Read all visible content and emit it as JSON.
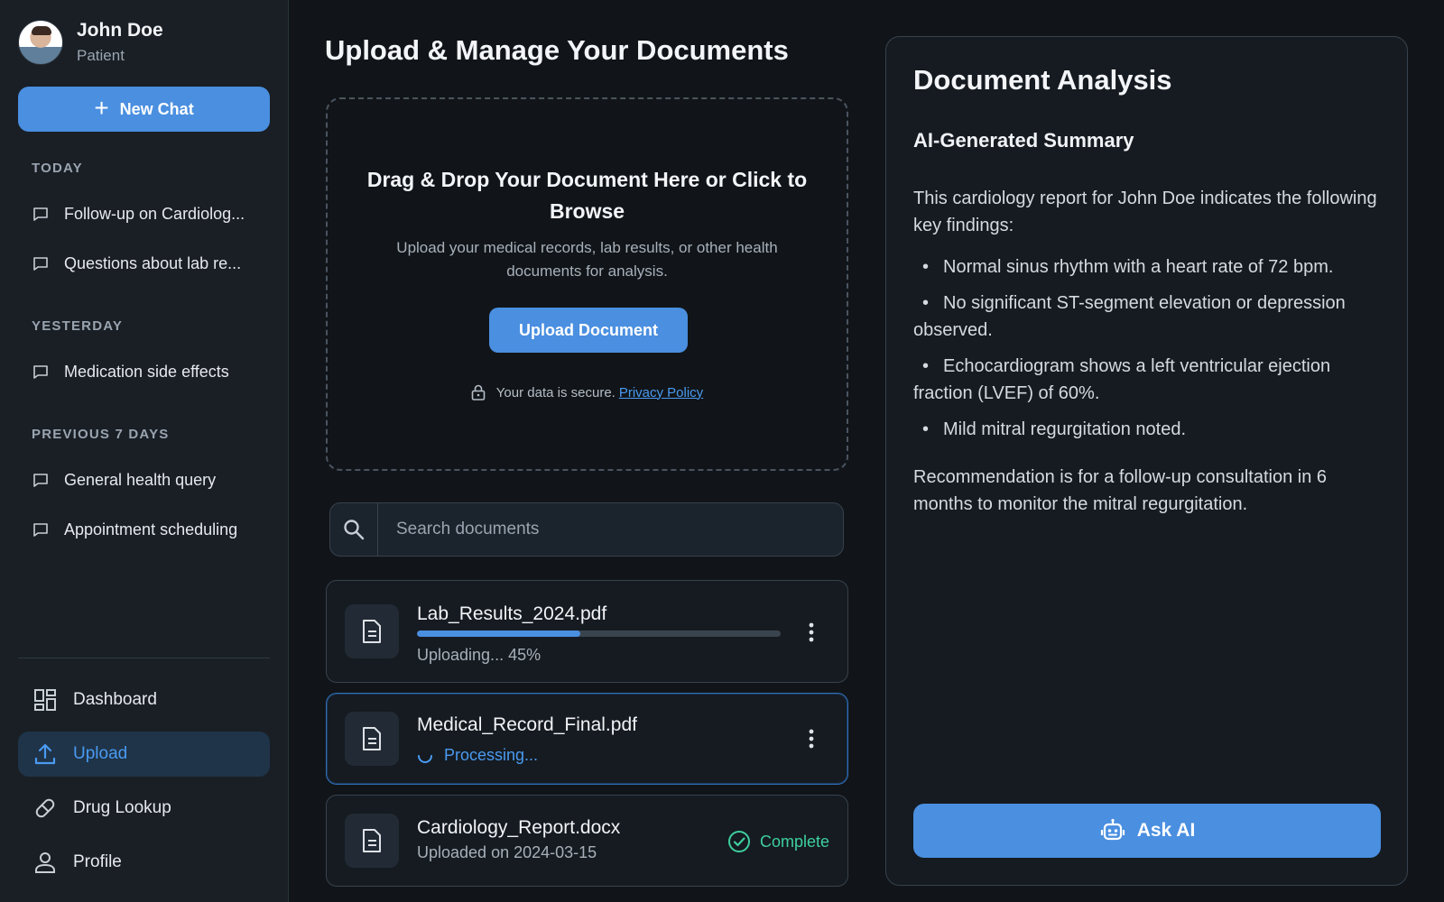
{
  "user": {
    "name": "John Doe",
    "role": "Patient"
  },
  "sidebar": {
    "new_chat_label": "New Chat",
    "sections": [
      {
        "label": "TODAY",
        "items": [
          "Follow-up on Cardiolog...",
          "Questions about lab re..."
        ]
      },
      {
        "label": "YESTERDAY",
        "items": [
          "Medication side effects"
        ]
      },
      {
        "label": "PREVIOUS 7 DAYS",
        "items": [
          "General health query",
          "Appointment scheduling"
        ]
      }
    ],
    "nav": [
      {
        "label": "Dashboard",
        "icon": "dashboard-icon",
        "active": false
      },
      {
        "label": "Upload",
        "icon": "upload-icon",
        "active": true
      },
      {
        "label": "Drug Lookup",
        "icon": "pill-icon",
        "active": false
      },
      {
        "label": "Profile",
        "icon": "person-icon",
        "active": false
      }
    ]
  },
  "main": {
    "title": "Upload & Manage Your Documents",
    "dropzone": {
      "title": "Drag & Drop Your Document Here or Click to Browse",
      "subtitle": "Upload your medical records, lab results, or other health documents for analysis.",
      "button_label": "Upload Document",
      "secure_text": "Your data is secure.",
      "privacy_link": "Privacy Policy"
    },
    "search": {
      "placeholder": "Search documents",
      "value": ""
    },
    "files": [
      {
        "name": "Lab_Results_2024.pdf",
        "status": "uploading",
        "status_text": "Uploading... 45%",
        "progress": 0.45
      },
      {
        "name": "Medical_Record_Final.pdf",
        "status": "processing",
        "status_text": "Processing..."
      },
      {
        "name": "Cardiology_Report.docx",
        "status": "complete",
        "status_text": "Uploaded on 2024-03-15",
        "badge": "Complete"
      }
    ]
  },
  "analysis": {
    "title": "Document Analysis",
    "subtitle": "AI-Generated Summary",
    "intro": "This cardiology report for John Doe indicates the following key findings:",
    "findings": [
      "Normal sinus rhythm with a heart rate of 72 bpm.",
      "No significant ST-segment elevation or depression observed.",
      "Echocardiogram shows a left ventricular ejection fraction (LVEF) of 60%.",
      "Mild mitral regurgitation noted."
    ],
    "recommendation": "Recommendation is for a follow-up consultation in 6 months to monitor the mitral regurgitation.",
    "ask_ai_label": "Ask AI"
  },
  "colors": {
    "accent": "#4a8fe0",
    "background": "#111519",
    "sidebar": "#191f25",
    "success": "#3ecf9e",
    "active_nav_bg": "#1f3449"
  }
}
